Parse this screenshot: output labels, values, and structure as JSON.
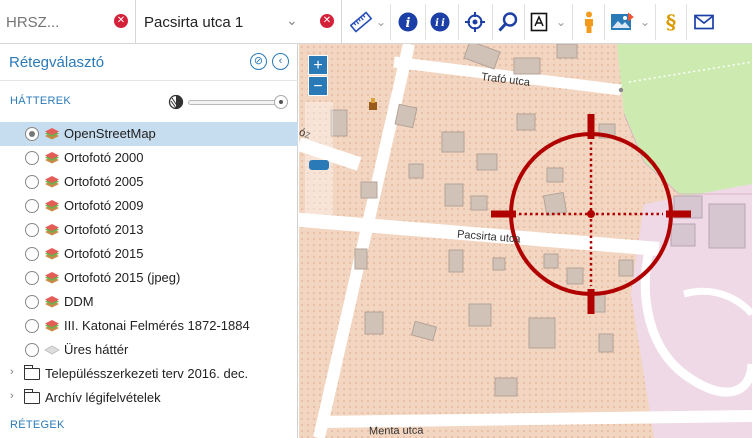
{
  "search": {
    "hrsz_placeholder": "HRSZ...",
    "street_value": "Pacsirta utca 1"
  },
  "toolbar": {
    "icons": [
      "ruler-icon",
      "info-icon",
      "multi-info-icon",
      "locate-icon",
      "search-icon",
      "print-icon",
      "person-icon",
      "image-icon",
      "paragraph-icon",
      "mail-icon"
    ]
  },
  "sidebar": {
    "title": "Rétegválasztó",
    "section_backgrounds": "HÁTTEREK",
    "section_layers": "RÉTEGEK",
    "layers": [
      {
        "label": "OpenStreetMap",
        "selected": true
      },
      {
        "label": "Ortofotó 2000",
        "selected": false
      },
      {
        "label": "Ortofotó 2005",
        "selected": false
      },
      {
        "label": "Ortofotó 2009",
        "selected": false
      },
      {
        "label": "Ortofotó 2013",
        "selected": false
      },
      {
        "label": "Ortofotó 2015",
        "selected": false
      },
      {
        "label": "Ortofotó 2015 (jpeg)",
        "selected": false
      },
      {
        "label": "DDM",
        "selected": false
      },
      {
        "label": "III. Katonai Felmérés 1872-1884",
        "selected": false
      },
      {
        "label": "Üres háttér",
        "selected": false
      }
    ],
    "folders": [
      {
        "label": "Településszerkezeti terv 2016. dec."
      },
      {
        "label": "Archív légifelvételek"
      }
    ]
  },
  "map": {
    "zoom_in": "+",
    "zoom_out": "−",
    "streets": {
      "trafo": "Trafó utca",
      "pacsirta": "Pacsirta utca",
      "menta": "Menta utca",
      "partial": "óz"
    },
    "colors": {
      "residential": "#f3d6c1",
      "park": "#cdebb0",
      "other_zone": "#efd9e6",
      "crosshair": "#b00000",
      "accent": "#2a7ab8"
    }
  }
}
